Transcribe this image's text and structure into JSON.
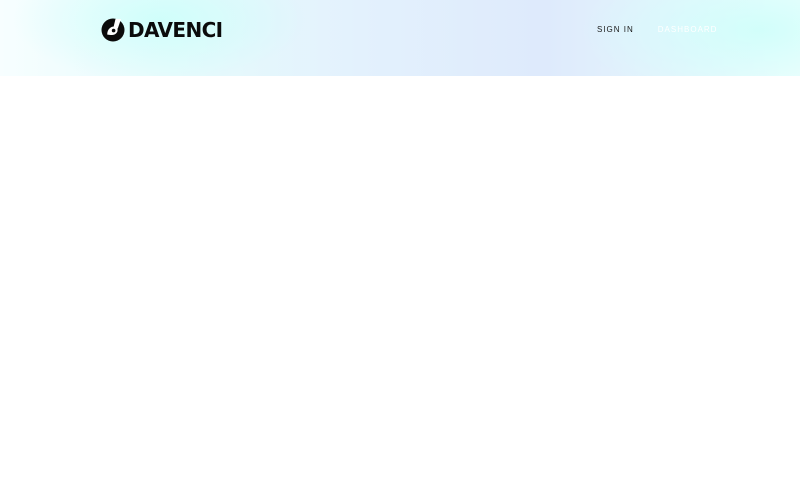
{
  "header": {
    "logo": {
      "icon": "davenci-logo-mark-icon",
      "text": "DAVENCI"
    },
    "nav": {
      "sign_in": "SIGN IN",
      "dashboard": "DASHBOARD"
    }
  },
  "colors": {
    "logo": "#0b0b0b",
    "nav_text": "#1a1a1a",
    "header_gradient": [
      "#f7feff",
      "#e6fbfc",
      "#e3f1fd",
      "#deeafc",
      "#f2fefe"
    ],
    "page_background": "#ffffff"
  }
}
